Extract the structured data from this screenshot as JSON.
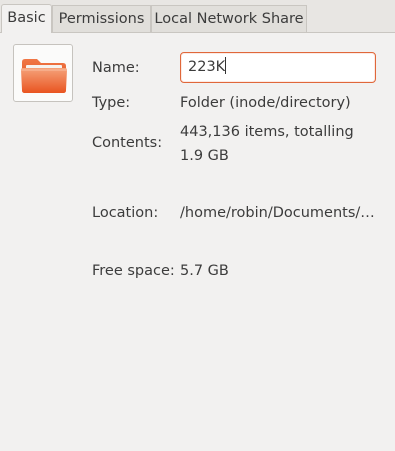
{
  "tabs": [
    {
      "label": "Basic"
    },
    {
      "label": "Permissions"
    },
    {
      "label": "Local Network Share"
    }
  ],
  "icon": {
    "name": "folder-icon",
    "color": "#e95420"
  },
  "fields": {
    "name_label": "Name:",
    "name_value": "223K",
    "type_label": "Type:",
    "type_value": "Folder (inode/directory)",
    "contents_label": "Contents:",
    "contents_value": "443,136 items, totalling 1.9 GB",
    "location_label": "Location:",
    "location_value": "/home/robin/Documents/…",
    "free_space_label": "Free space:",
    "free_space_value": "5.7 GB"
  }
}
